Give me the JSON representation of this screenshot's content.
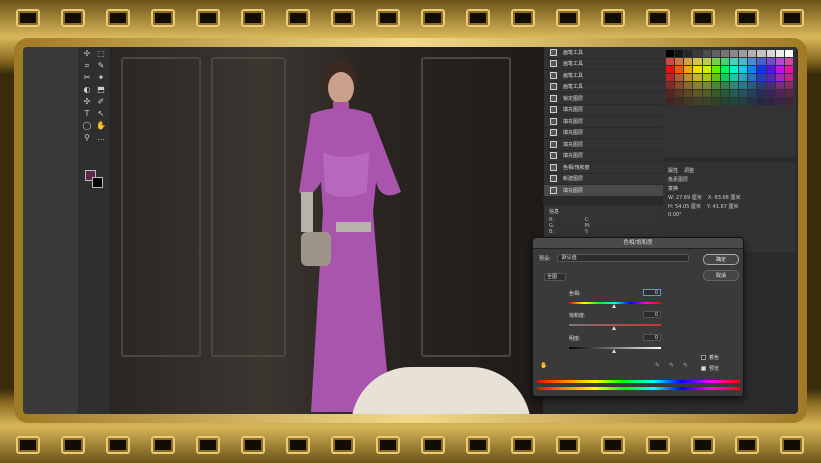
{
  "layers": [
    {
      "name": "画笔工具",
      "selected": false
    },
    {
      "name": "画笔工具",
      "selected": false
    },
    {
      "name": "画笔工具",
      "selected": false
    },
    {
      "name": "画笔工具",
      "selected": false
    },
    {
      "name": "锁定图层",
      "selected": false
    },
    {
      "name": "填充图层",
      "selected": false
    },
    {
      "name": "填充图层",
      "selected": false
    },
    {
      "name": "填充图层",
      "selected": false
    },
    {
      "name": "填充图层",
      "selected": false
    },
    {
      "name": "填充图层",
      "selected": false
    },
    {
      "name": "色相/饱和度",
      "selected": false
    },
    {
      "name": "新建图层",
      "selected": false
    },
    {
      "name": "填充图层",
      "selected": true
    }
  ],
  "info": {
    "title": "信息",
    "r": "R:",
    "g": "G:",
    "b": "B:",
    "c": "C:",
    "m": "M:",
    "y": "Y:"
  },
  "properties": {
    "tab1": "属性",
    "tab2": "调整",
    "layer_label": "像素图层",
    "transform": "变换",
    "w": "W: 27.69 厘米",
    "x": "X: 83.68 厘米",
    "h": "H: 54.05 厘米",
    "y": "Y: 41.67 厘米",
    "angle": "0.00°"
  },
  "dialog": {
    "title": "色相/饱和度",
    "preset_label": "预设:",
    "preset_value": "默认值",
    "ok": "确定",
    "cancel": "取消",
    "channel": "全图",
    "hue_label": "色相:",
    "hue_value": "0",
    "sat_label": "饱和度:",
    "sat_value": "0",
    "light_label": "明度:",
    "light_value": "0",
    "colorize": "着色",
    "preview": "预览",
    "colorize_checked": false,
    "preview_checked": true
  },
  "colors": {
    "dress": "#b262b8",
    "fg_swatch": "#5a2a4d",
    "bg_swatch": "#000000"
  }
}
